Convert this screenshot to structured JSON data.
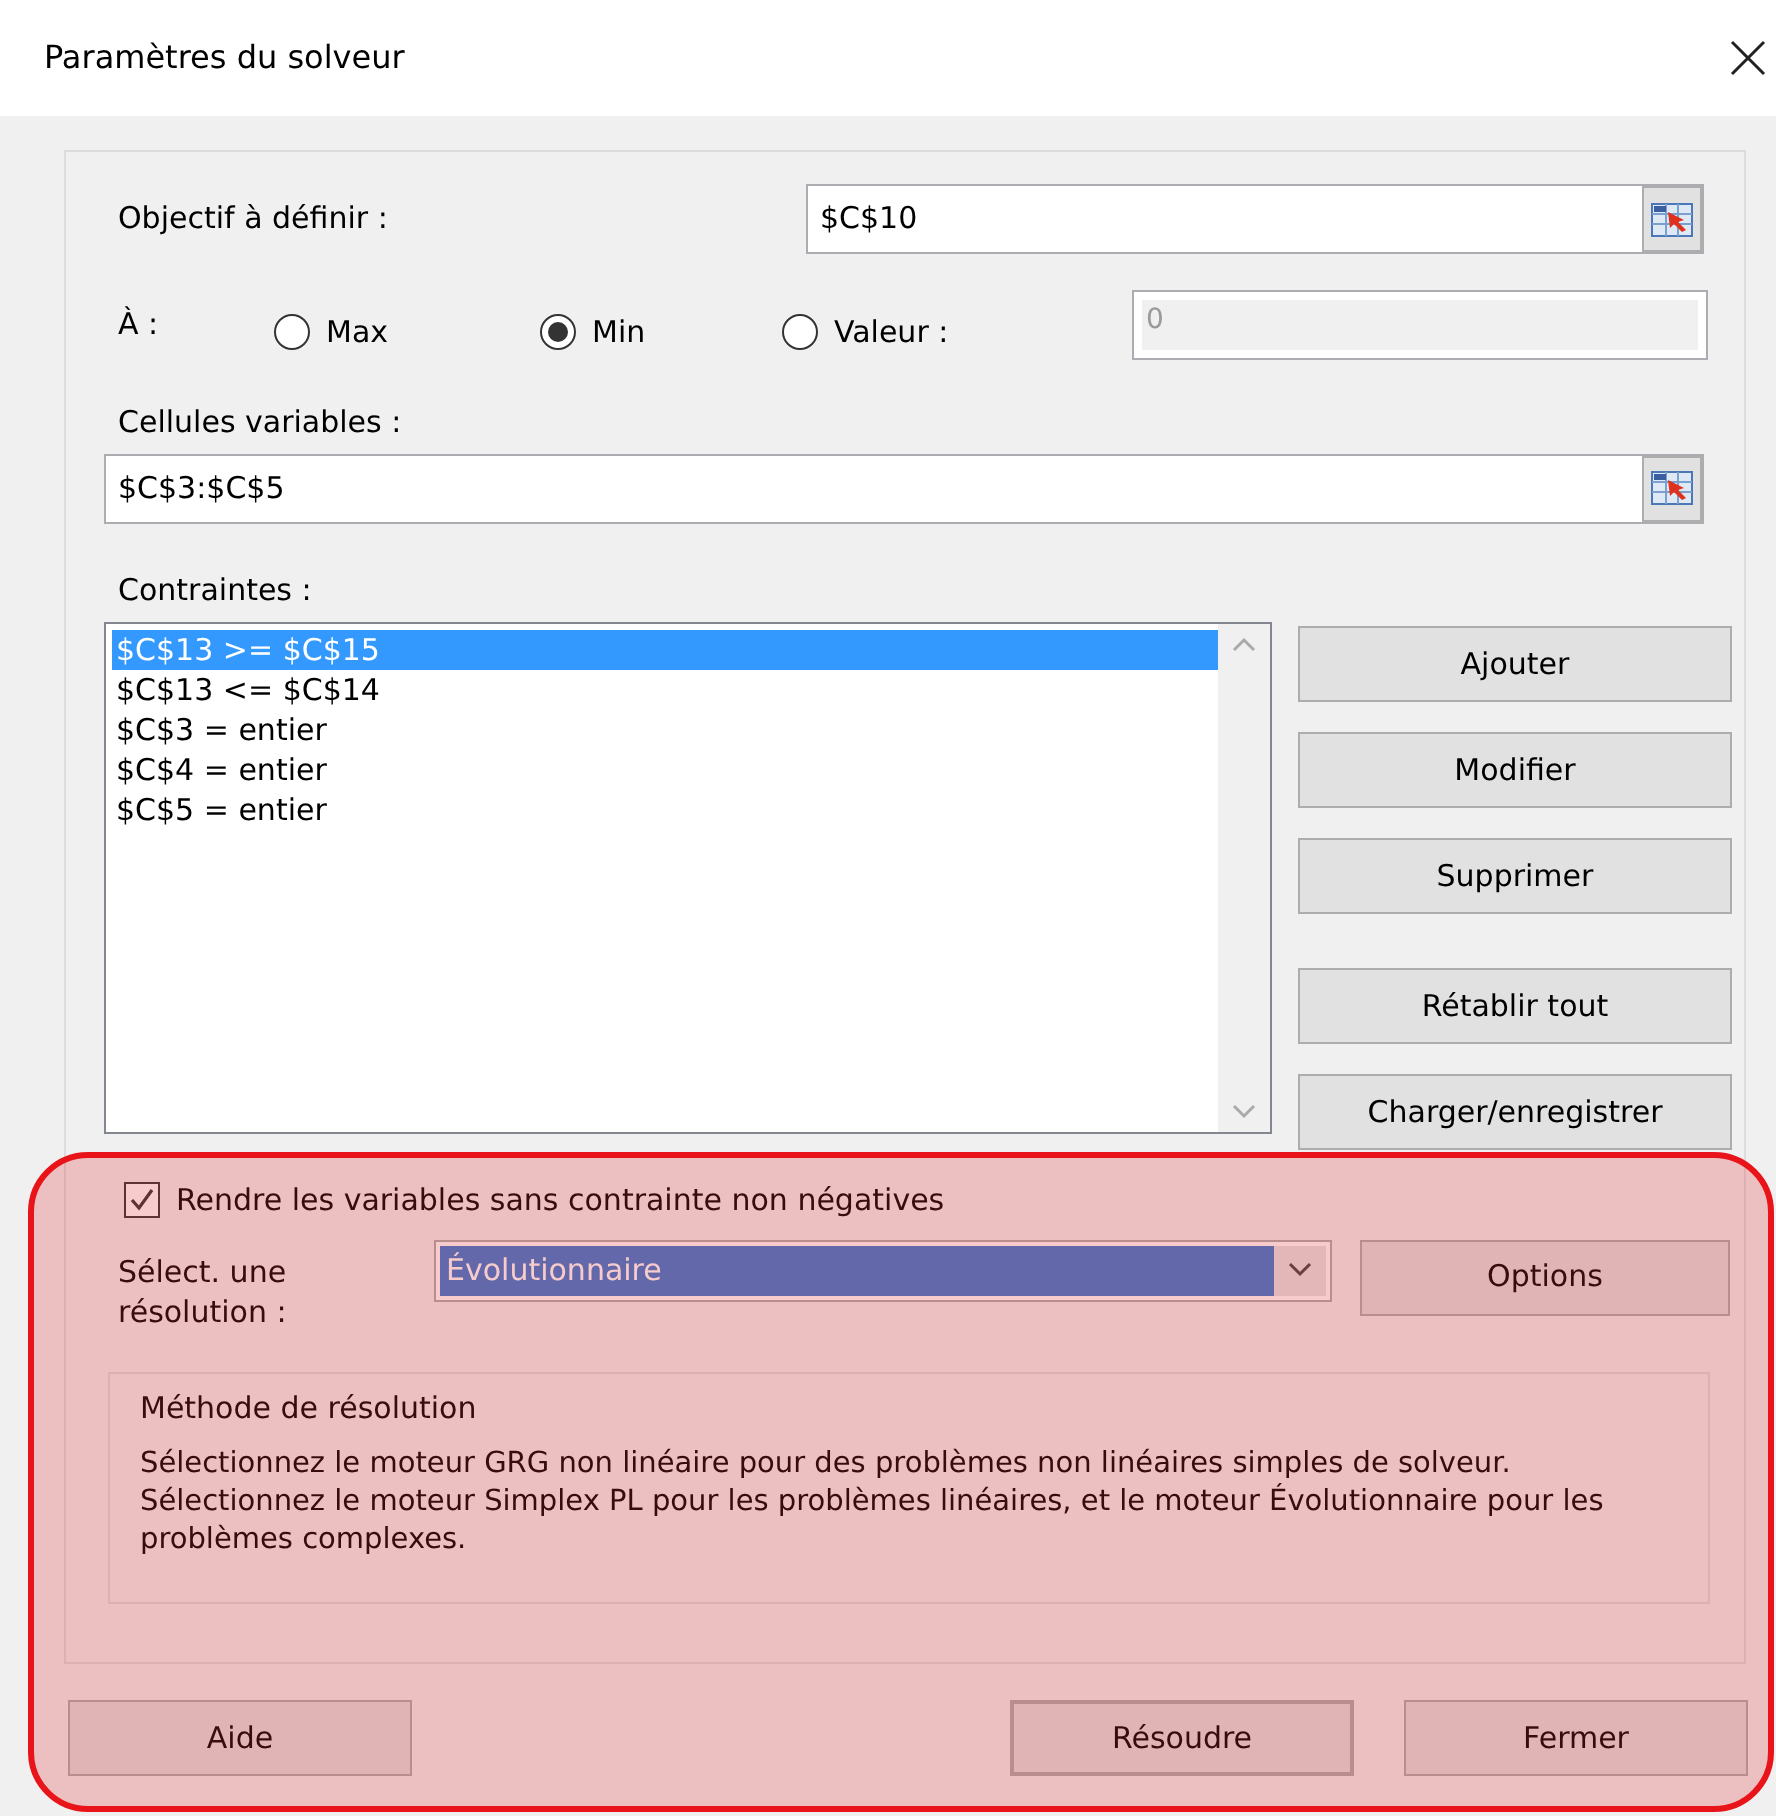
{
  "window": {
    "title": "Paramètres du solveur"
  },
  "objective": {
    "label": "Objectif à définir :",
    "value": "$C$10"
  },
  "target": {
    "label": "À :",
    "options": [
      {
        "label": "Max",
        "selected": false
      },
      {
        "label": "Min",
        "selected": true
      },
      {
        "label": "Valeur :",
        "selected": false
      }
    ],
    "value": "0",
    "disabled": true
  },
  "variables": {
    "label": "Cellules variables :",
    "value": "$C$3:$C$5"
  },
  "constraints": {
    "label": "Contraintes :",
    "items": [
      {
        "text": "$C$13 >= $C$15",
        "selected": true
      },
      {
        "text": "$C$13 <= $C$14",
        "selected": false
      },
      {
        "text": "$C$3 = entier",
        "selected": false
      },
      {
        "text": "$C$4 = entier",
        "selected": false
      },
      {
        "text": "$C$5 = entier",
        "selected": false
      }
    ]
  },
  "side_buttons": [
    "Ajouter",
    "Modifier",
    "Supprimer",
    "Rétablir tout",
    "Charger/enregistrer"
  ],
  "nonnegative": {
    "label": "Rendre les variables sans contrainte non négatives",
    "checked": true
  },
  "method": {
    "label": "Sélect. une résolution :",
    "value": "Évolutionnaire",
    "options_button": "Options"
  },
  "method_box": {
    "title": "Méthode de résolution",
    "text": "Sélectionnez le moteur GRG non linéaire pour des problèmes non linéaires simples de solveur. Sélectionnez le moteur Simplex PL pour les problèmes linéaires, et le moteur Évolutionnaire pour les problèmes complexes."
  },
  "footer_buttons": [
    {
      "label": "Aide",
      "default": false
    },
    {
      "label": "Résoudre",
      "default": true
    },
    {
      "label": "Fermer",
      "default": false
    }
  ],
  "highlight": true
}
